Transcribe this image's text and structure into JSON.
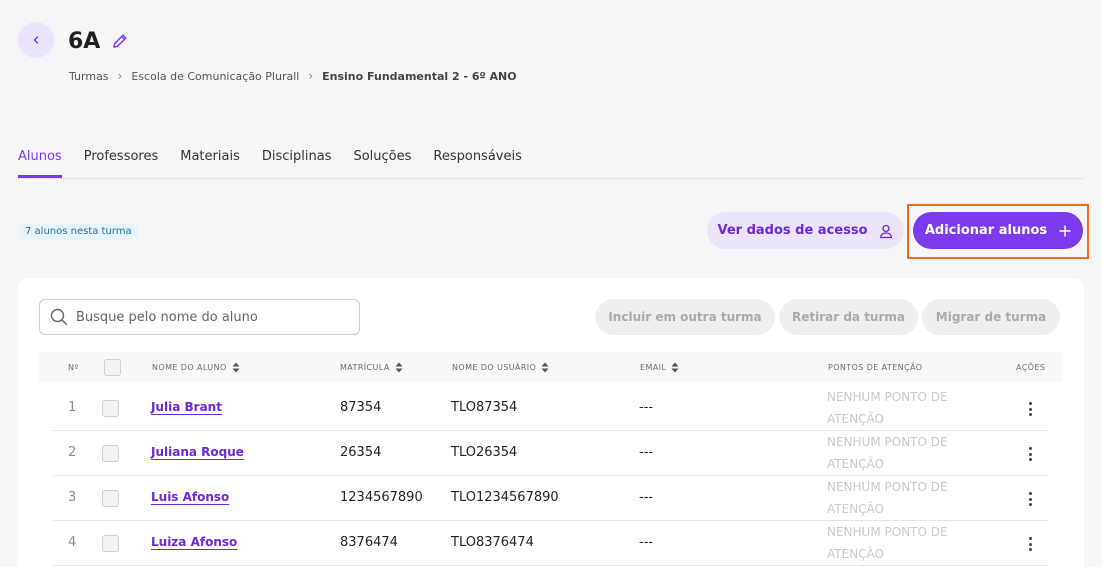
{
  "header": {
    "title": "6A",
    "breadcrumb": [
      "Turmas",
      "Escola de Comunicação Plurall",
      "Ensino Fundamental 2 - 6º ANO"
    ]
  },
  "tabs": [
    {
      "label": "Alunos",
      "active": true
    },
    {
      "label": "Professores",
      "active": false
    },
    {
      "label": "Materiais",
      "active": false
    },
    {
      "label": "Disciplinas",
      "active": false
    },
    {
      "label": "Soluções",
      "active": false
    },
    {
      "label": "Responsáveis",
      "active": false
    }
  ],
  "toolbar": {
    "count_label": "7 alunos nesta turma",
    "access_label": "Ver dados de acesso",
    "add_label": "Adicionar alunos"
  },
  "search": {
    "placeholder": "Busque pelo nome do aluno",
    "value": ""
  },
  "bulk_actions": {
    "include": "Incluir em outra turma",
    "remove": "Retirar da turma",
    "migrate": "Migrar de turma"
  },
  "table": {
    "columns": {
      "num": "Nº",
      "name": "NOME DO ALUNO",
      "registration": "MATRÍCULA",
      "username": "NOME DO USUÁRIO",
      "email": "EMAIL",
      "attention": "PONTOS DE ATENÇÃO",
      "actions": "AÇÕES"
    },
    "rows": [
      {
        "num": "1",
        "name": "Julia Brant",
        "registration": "87354",
        "username": "TLO87354",
        "email": "---",
        "attention": "NENHUM PONTO DE ATENÇÃO"
      },
      {
        "num": "2",
        "name": "Juliana Roque",
        "registration": "26354",
        "username": "TLO26354",
        "email": "---",
        "attention": "NENHUM PONTO DE ATENÇÃO"
      },
      {
        "num": "3",
        "name": "Luis Afonso",
        "registration": "1234567890",
        "username": "TLO1234567890",
        "email": "---",
        "attention": "NENHUM PONTO DE ATENÇÃO"
      },
      {
        "num": "4",
        "name": "Luiza Afonso",
        "registration": "8376474",
        "username": "TLO8376474",
        "email": "---",
        "attention": "NENHUM PONTO DE ATENÇÃO"
      }
    ]
  },
  "colors": {
    "accent": "#7c3aed",
    "accent_light": "#ece4fb",
    "highlight_border": "#f26a21"
  },
  "icons": [
    "chevron-left-icon",
    "pencil-icon",
    "chevron-right-icon",
    "user-icon",
    "plus-icon",
    "search-icon",
    "sort-icon",
    "kebab-menu-icon"
  ]
}
